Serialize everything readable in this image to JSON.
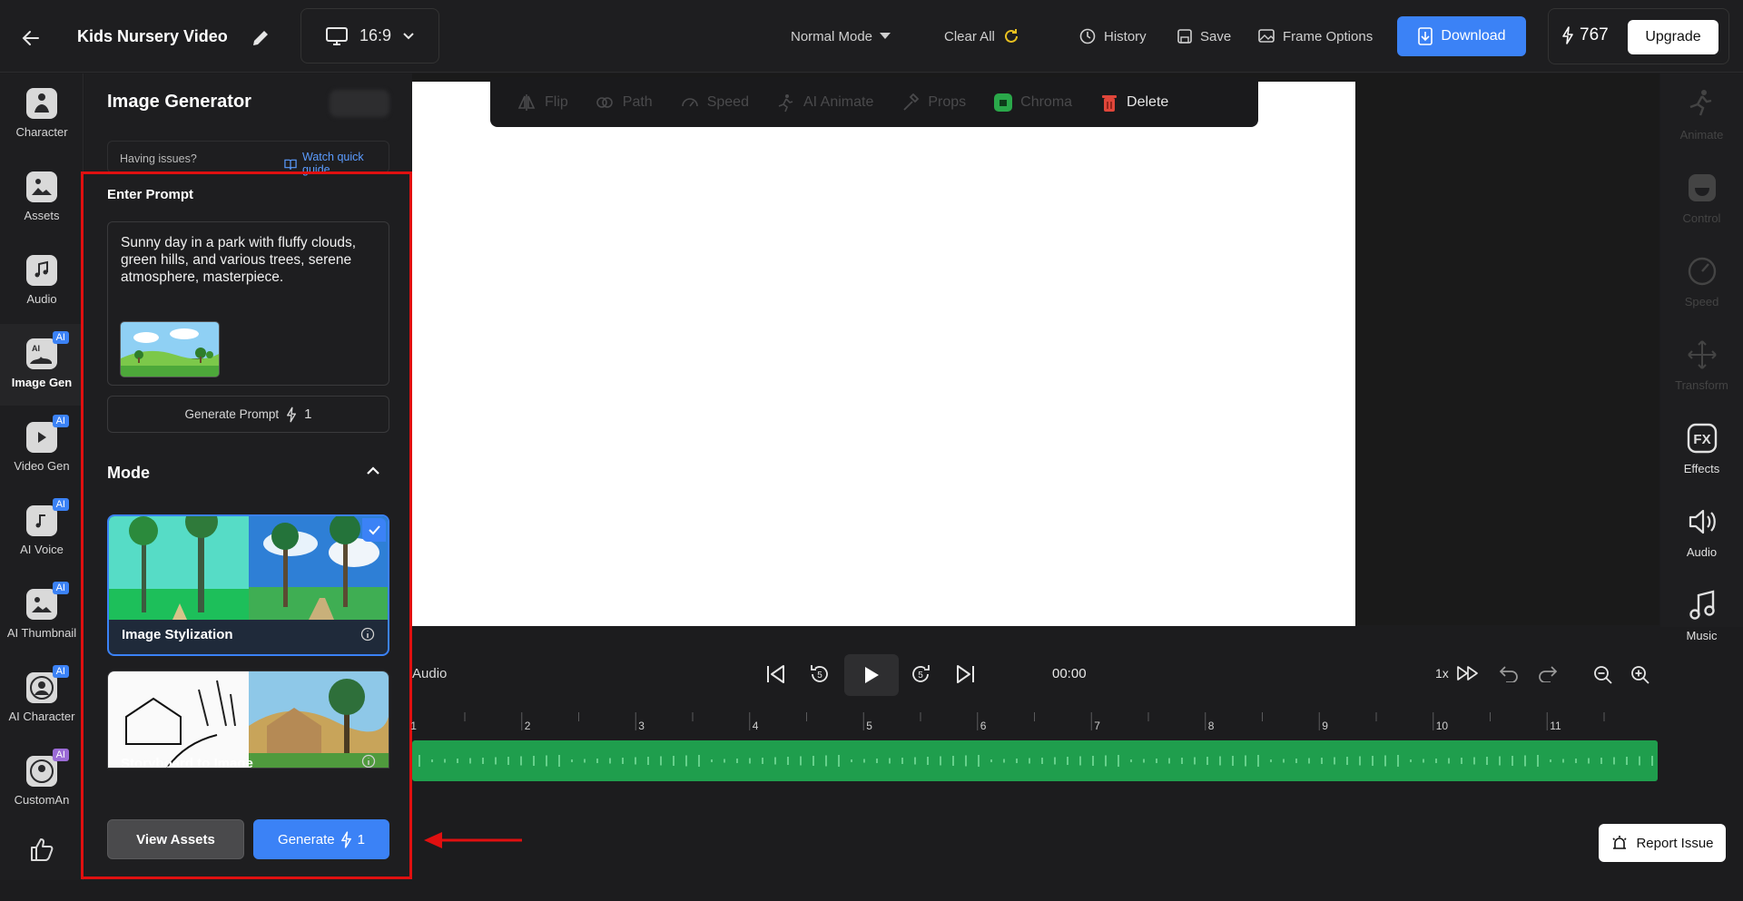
{
  "header": {
    "project_title": "Kids Nursery Video",
    "aspect_ratio": "16:9",
    "mode": "Normal Mode",
    "clear_all": "Clear All",
    "history": "History",
    "save": "Save",
    "frame_options": "Frame Options",
    "download": "Download",
    "credits": "767",
    "upgrade": "Upgrade"
  },
  "left_rail": [
    {
      "label": "Character",
      "icon": "character-icon",
      "ai": false
    },
    {
      "label": "Assets",
      "icon": "assets-icon",
      "ai": false
    },
    {
      "label": "Audio",
      "icon": "audio-icon",
      "ai": false
    },
    {
      "label": "Image Gen",
      "icon": "image-gen-icon",
      "ai": true,
      "active": true
    },
    {
      "label": "Video Gen",
      "icon": "video-gen-icon",
      "ai": true
    },
    {
      "label": "AI Voice",
      "icon": "ai-voice-icon",
      "ai": true
    },
    {
      "label": "AI Thumbnail",
      "icon": "ai-thumbnail-icon",
      "ai": true
    },
    {
      "label": "AI Character",
      "icon": "ai-character-icon",
      "ai": true
    },
    {
      "label": "CustomAn",
      "icon": "custom-animation-icon",
      "ai": true
    },
    {
      "label": "",
      "icon": "thumbs-up-icon",
      "ai": false
    }
  ],
  "ai_badge": "AI",
  "panel": {
    "title": "Image Generator",
    "having_issues": "Having issues?",
    "watch_guide": "Watch quick guide",
    "enter_prompt": "Enter Prompt",
    "prompt_text": "Sunny day in a park with fluffy clouds, green hills, and various trees, serene atmosphere, masterpiece.",
    "generate_prompt": "Generate Prompt",
    "generate_prompt_cost": "1",
    "mode_label": "Mode",
    "modes": [
      {
        "name": "Image Stylization",
        "selected": true
      },
      {
        "name": "Storyboard to Image",
        "selected": false
      }
    ],
    "view_assets": "View Assets",
    "generate": "Generate",
    "generate_cost": "1"
  },
  "toolbar": [
    {
      "label": "Flip",
      "icon": "flip-icon",
      "enabled": false
    },
    {
      "label": "Path",
      "icon": "path-icon",
      "enabled": false
    },
    {
      "label": "Speed",
      "icon": "speed-icon",
      "enabled": false
    },
    {
      "label": "AI Animate",
      "icon": "ai-animate-icon",
      "enabled": false
    },
    {
      "label": "Props",
      "icon": "props-icon",
      "enabled": false
    },
    {
      "label": "Chroma",
      "icon": "chroma-icon",
      "enabled": false
    },
    {
      "label": "Delete",
      "icon": "trash-icon",
      "enabled": true
    }
  ],
  "right_rail": [
    {
      "label": "Animate",
      "icon": "animate-icon",
      "enabled": false
    },
    {
      "label": "Control",
      "icon": "control-icon",
      "enabled": false
    },
    {
      "label": "Speed",
      "icon": "speedometer-icon",
      "enabled": false
    },
    {
      "label": "Transform",
      "icon": "transform-icon",
      "enabled": false
    },
    {
      "label": "Effects",
      "icon": "effects-icon",
      "enabled": true
    },
    {
      "label": "Audio",
      "icon": "volume-icon",
      "enabled": true
    },
    {
      "label": "Music",
      "icon": "music-icon",
      "enabled": true
    }
  ],
  "playback": {
    "audio_label": "Audio",
    "time": "00:00",
    "speed": "1x",
    "rewind_seconds": "5",
    "forward_seconds": "5"
  },
  "timeline": {
    "ticks": [
      "1",
      "2",
      "3",
      "4",
      "5",
      "6",
      "7",
      "8",
      "9",
      "10",
      "11"
    ]
  },
  "report_issue": "Report Issue",
  "colors": {
    "accent": "#3b82f6",
    "highlight_box": "#e01010",
    "audio_track": "#1f9e4d"
  }
}
